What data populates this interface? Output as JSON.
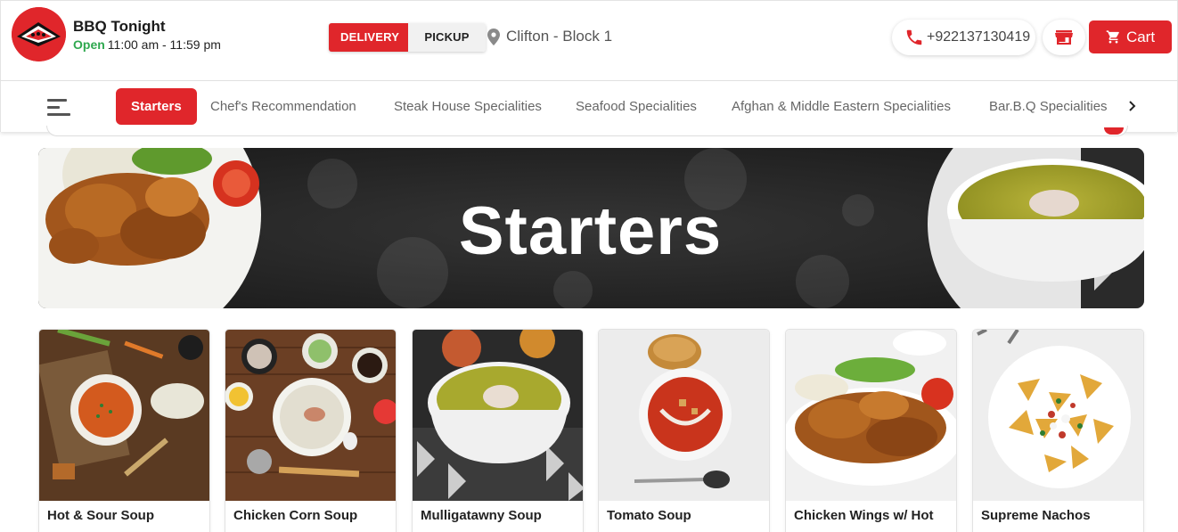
{
  "header": {
    "brand_name": "BBQ Tonight",
    "status": "Open",
    "hours": "11:00 am - 11:59 pm",
    "delivery_label": "DELIVERY",
    "pickup_label": "PICKUP",
    "location": "Clifton - Block 1",
    "phone": "+922137130419",
    "cart_label": "Cart",
    "selected_mode": "DELIVERY"
  },
  "categories": {
    "active": "Starters",
    "items": [
      "Starters",
      "Chef's Recommendation",
      "Steak House Specialities",
      "Seafood Specialities",
      "Afghan & Middle Eastern Specialities",
      "Bar.B.Q Specialities"
    ]
  },
  "banner": {
    "title": "Starters"
  },
  "products": [
    {
      "name": "Hot & Sour Soup"
    },
    {
      "name": "Chicken Corn Soup"
    },
    {
      "name": "Mulligatawny Soup"
    },
    {
      "name": "Tomato Soup"
    },
    {
      "name": "Chicken Wings w/ Hot"
    },
    {
      "name": "Supreme Nachos"
    }
  ],
  "colors": {
    "accent": "#e0262b",
    "open": "#2fa84f"
  },
  "icons": {
    "location": "map-pin-icon",
    "phone": "phone-icon",
    "store": "store-icon",
    "cart": "shopping-cart-icon",
    "menu": "hamburger-menu-icon",
    "next": "chevron-right-icon"
  }
}
